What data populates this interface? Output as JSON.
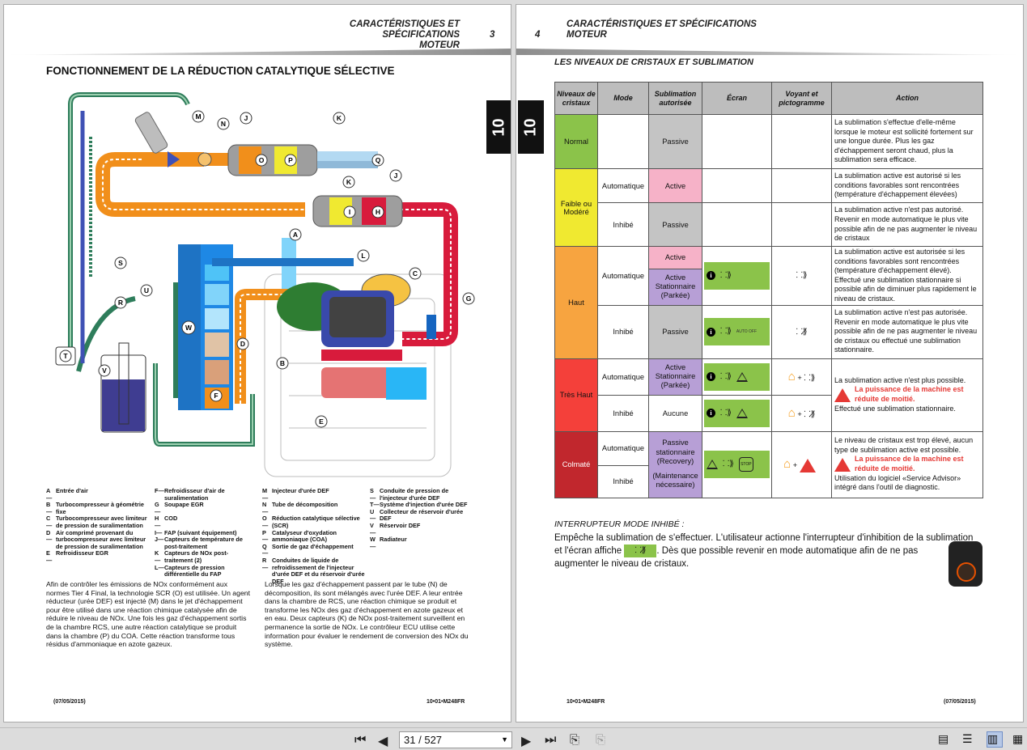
{
  "viewer": {
    "page_current": "31",
    "page_sep": "/",
    "page_total": "527"
  },
  "left": {
    "header_line1": "CARACTÉRISTIQUES ET SPÉCIFICATIONS",
    "header_line2": "MOTEUR",
    "page_num": "3",
    "tab": "10",
    "title": "FONCTIONNEMENT DE LA RÉDUCTION CATALYTIQUE SÉLECTIVE",
    "diagram_labels": [
      "A",
      "B",
      "C",
      "D",
      "E",
      "F",
      "G",
      "H",
      "I",
      "J",
      "K",
      "L",
      "M",
      "N",
      "O",
      "P",
      "Q",
      "R",
      "S",
      "T",
      "U",
      "V",
      "W"
    ],
    "legend": {
      "col1": [
        {
          "k": "A—",
          "v": "Entrée d'air"
        },
        {
          "k": "B—",
          "v": "Turbocompresseur à géométrie fixe"
        },
        {
          "k": "C—",
          "v": "Turbocompresseur avec limiteur de pression de suralimentation"
        },
        {
          "k": "D—",
          "v": "Air comprimé provenant du turbocompresseur avec limiteur de pression de suralimentation"
        },
        {
          "k": "E—",
          "v": "Refroidisseur EGR"
        }
      ],
      "col2": [
        {
          "k": "F—",
          "v": "Refroidisseur d'air de suralimentation"
        },
        {
          "k": "G—",
          "v": "Soupape EGR"
        },
        {
          "k": "H—",
          "v": "COD"
        },
        {
          "k": "I—",
          "v": "FAP (suivant équipement)"
        },
        {
          "k": "J—",
          "v": "Capteurs de température de post-traitement"
        },
        {
          "k": "K—",
          "v": "Capteurs de NOx post-traitement (2)"
        },
        {
          "k": "L—",
          "v": "Capteurs de pression différentielle du FAP"
        }
      ],
      "col3": [
        {
          "k": "M—",
          "v": "Injecteur d'urée DEF"
        },
        {
          "k": "N—",
          "v": "Tube de décomposition"
        },
        {
          "k": "O—",
          "v": "Réduction catalytique sélective (SCR)"
        },
        {
          "k": "P—",
          "v": "Catalyseur d'oxydation ammoniaque (COA)"
        },
        {
          "k": "Q—",
          "v": "Sortie de gaz d'échappement"
        },
        {
          "k": "R—",
          "v": "Conduites de liquide de refroidissement de l'injecteur d'urée DEF et du réservoir d'urée DEF"
        }
      ],
      "col4": [
        {
          "k": "S—",
          "v": "Conduite de pression de l'injecteur d'urée DEF"
        },
        {
          "k": "T—",
          "v": "Système d'injection d'urée DEF"
        },
        {
          "k": "U—",
          "v": "Collecteur de réservoir d'urée DEF"
        },
        {
          "k": "V—",
          "v": "Réservoir DEF"
        },
        {
          "k": "W—",
          "v": "Radiateur"
        }
      ]
    },
    "para1": "Afin de contrôler les émissions de NOx conformément aux normes Tier 4 Final, la technologie SCR (O) est utilisée. Un agent réducteur (urée DEF) est injecté (M) dans le jet d'échappement pour être utilisé dans une réaction chimique catalysée afin de réduire le niveau de NOx. Une fois les gaz d'échappement sortis de la chambre RCS, une autre réaction catalytique se produit dans la chambre (P) du COA. Cette réaction transforme tous résidus d'ammoniaque en azote gazeux.",
    "para2": "Lorsque les gaz d'échappement passent par le tube (N) de décomposition, ils sont mélangés avec l'urée DEF. A leur entrée dans la chambre de RCS, une réaction chimique se produit et transforme les NOx des gaz d'échappement en azote gazeux et en eau. Deux capteurs (K) de NOx post-traitement surveillent en permanence la sortie de NOx. Le contrôleur ECU utilise cette information pour évaluer le rendement de conversion des NOx du système.",
    "foot_date": "(07/05/2015)",
    "foot_ref": "10•01•M248FR"
  },
  "right": {
    "header_line1": "CARACTÉRISTIQUES ET SPÉCIFICATIONS",
    "header_line2": "MOTEUR",
    "page_num": "4",
    "tab": "10",
    "title": "LES NIVEAUX DE CRISTAUX ET SUBLIMATION",
    "table_headers": {
      "niveaux": "Niveaux de cristaux",
      "mode": "Mode",
      "subl": "Sublimation autorisée",
      "ecran": "Écran",
      "voyant": "Voyant et pictogramme",
      "action": "Action"
    },
    "levels": {
      "normal": "Normal",
      "faible": "Faible ou Modéré",
      "haut": "Haut",
      "tres_haut": "Très Haut",
      "colmate": "Colmaté"
    },
    "modes": {
      "auto": "Automatique",
      "inhibe": "Inhibé"
    },
    "subl": {
      "passive": "Passive",
      "active": "Active",
      "active_stat": "Active Stationnaire (Parkée)",
      "aucune": "Aucune",
      "passive_recovery": "Passive stationnaire (Recovery)",
      "maintenance": "(Maintenance nécessaire)"
    },
    "actions": {
      "normal": "La sublimation s'effectue d'elle-même lorsque le moteur est sollicité fortement sur une longue durée. Plus les gaz d'échappement seront chaud, plus la sublimation sera efficace.",
      "faible_auto": "La sublimation active est autorisé si les conditions favorables sont rencontrées (température d'échappement élevées)",
      "faible_inhibe": "La sublimation active n'est pas autorisé. Revenir en mode automatique le plus vite possible afin de ne pas augmenter le niveau de cristaux",
      "haut_auto": "La sublimation active est autorisée si les conditions favorables sont rencontrées (température d'échappement élevé). Effectué une sublimation stationnaire si possible afin de diminuer plus rapidement le niveau de cristaux.",
      "haut_inhibe": "La sublimation active n'est pas autorisée. Revenir en mode automatique le plus vite possible afin de ne pas augmenter le niveau de cristaux ou effectué une sublimation stationnaire.",
      "tres_haut_1": "La sublimation active n'est plus possible.",
      "warn_1": "La puissance de la machine est",
      "warn_2": "réduite de moitié.",
      "tres_haut_2": "Effectué une sublimation stationnaire.",
      "colmate_1": "Le niveau de cristaux est trop élevé, aucun type de sublimation active est possible.",
      "colmate_2": "Utilisation du logiciel «Service Advisor» intégré dans l'outil de diagnostic."
    },
    "screen_text": {
      "auto_off": "AUTO OFF",
      "stop": "STOP"
    },
    "interrupt_title": "INTERRUPTEUR MODE INHIBÉ :",
    "interrupt_p1": "Empêche la sublimation de s'effectuer. L'utilisateur actionne l'interrupteur d'inhibition de la sublimation",
    "interrupt_p2a": "et l'écran affiche",
    "interrupt_p2b": ". Dès que possible revenir en mode automatique afin de ne pas",
    "interrupt_p3": "augmenter le niveau de cristaux.",
    "foot_ref": "10•01•M248FR",
    "foot_date": "(07/05/2015)"
  },
  "colors": {
    "normal": "#8bc34a",
    "faible": "#f0e930",
    "haut": "#f7a440",
    "tres_haut": "#f4403a",
    "colmate": "#c1272d",
    "active": "#f6b2c8",
    "passive": "#c4c4c4",
    "active_stat": "#b79fd6",
    "screen": "#8bc34a"
  }
}
